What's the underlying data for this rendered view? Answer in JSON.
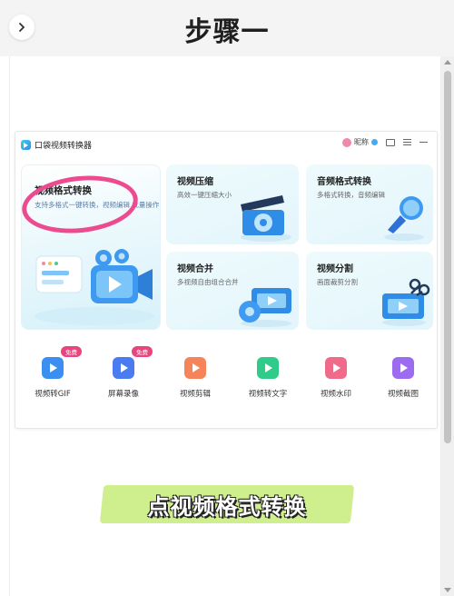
{
  "header": {
    "title": "步骤一"
  },
  "app": {
    "title": "口袋视频转换器",
    "user": "昵称"
  },
  "cards": {
    "video_format": {
      "title": "视频格式转换",
      "desc": "支持多格式一键转换，视频编辑 批量操作"
    },
    "video_compress": {
      "title": "视频压缩",
      "desc": "高效一键压缩大小"
    },
    "audio_format": {
      "title": "音频格式转换",
      "desc": "多格式转换，音频编辑"
    },
    "video_merge": {
      "title": "视频合并",
      "desc": "多视频自由组合合并"
    },
    "video_split": {
      "title": "视频分割",
      "desc": "画面裁剪分割"
    }
  },
  "tools": [
    {
      "label": "视频转GIF",
      "badge": "免费",
      "color": "#3a8ff0"
    },
    {
      "label": "屏幕录像",
      "badge": "免费",
      "color": "#4a7bf0"
    },
    {
      "label": "视频剪辑",
      "badge": "",
      "color": "#f5845a"
    },
    {
      "label": "视频转文字",
      "badge": "",
      "color": "#2ecb8a"
    },
    {
      "label": "视频水印",
      "badge": "",
      "color": "#f06a8a"
    },
    {
      "label": "视频截图",
      "badge": "",
      "color": "#9b6cf0"
    }
  ],
  "cta": {
    "text": "点视频格式转换"
  },
  "colors": {
    "accent": "#ec4c8f",
    "cta_bg": "#cfee8e"
  }
}
